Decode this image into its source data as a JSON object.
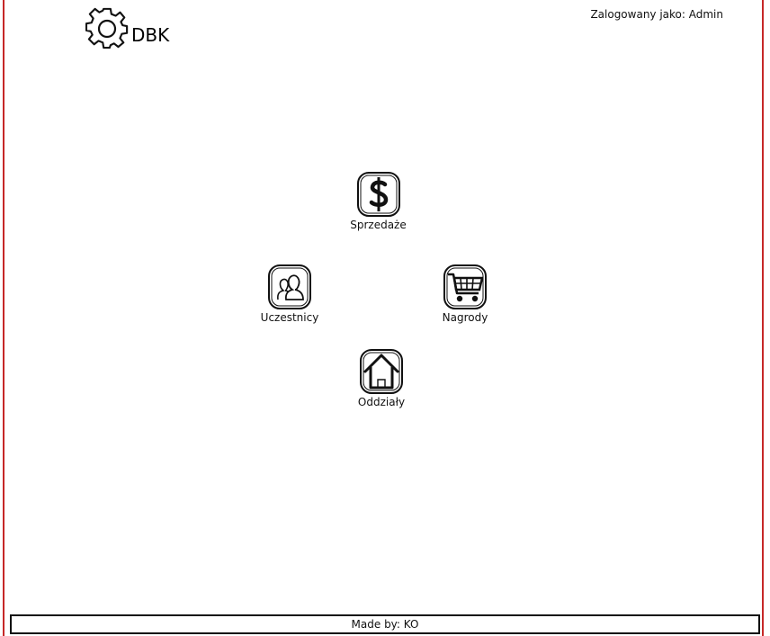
{
  "header": {
    "app_title": "DBK",
    "logged_in_text": "Zalogowany jako: Admin",
    "logo_icon": "gear-icon"
  },
  "menu": {
    "sales": {
      "label": "Sprzedaże",
      "icon": "dollar-icon"
    },
    "participants": {
      "label": "Uczestnicy",
      "icon": "users-icon"
    },
    "prizes": {
      "label": "Nagrody",
      "icon": "cart-icon"
    },
    "branches": {
      "label": "Oddziały",
      "icon": "home-icon"
    }
  },
  "footer": {
    "text": "Made by: KO"
  },
  "colors": {
    "frame": "#c62828",
    "ink": "#111111"
  }
}
